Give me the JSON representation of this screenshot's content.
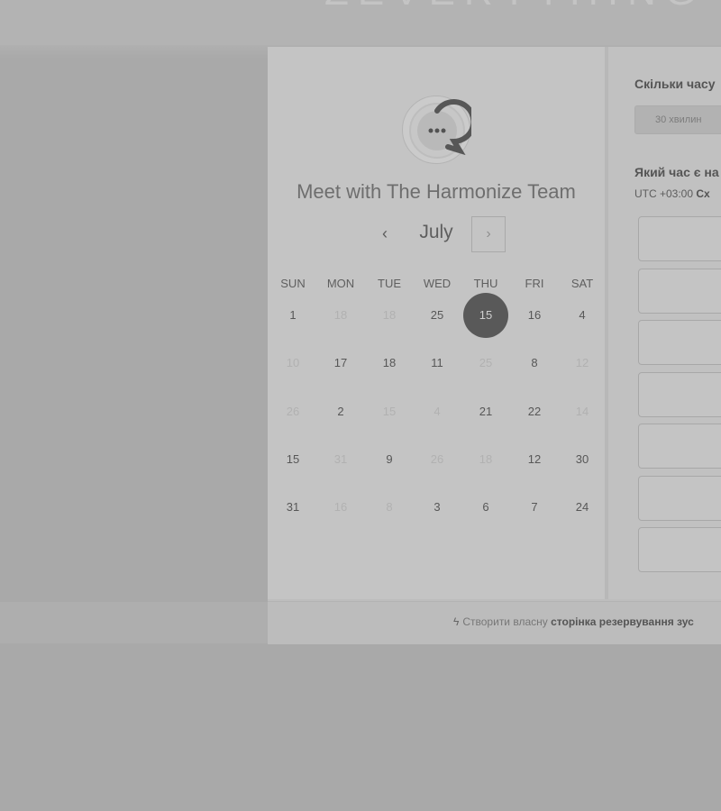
{
  "meeting": {
    "title": "Meet with The Harmonize Team",
    "avatar_icon": "chat-dots-icon"
  },
  "calendar": {
    "month": "July",
    "prev_icon": "chevron-left-icon",
    "next_icon": "chevron-right-icon",
    "weekdays": [
      "SUN",
      "MON",
      "TUE",
      "WED",
      "THU",
      "FRI",
      "SAT"
    ],
    "weeks": [
      [
        {
          "d": "1",
          "muted": false
        },
        {
          "d": "18",
          "muted": true
        },
        {
          "d": "18",
          "muted": true
        },
        {
          "d": "25",
          "muted": false
        },
        {
          "d": "15",
          "muted": false,
          "selected": true
        },
        {
          "d": "16",
          "muted": false
        },
        {
          "d": "4",
          "muted": false
        }
      ],
      [
        {
          "d": "10",
          "muted": true
        },
        {
          "d": "17",
          "muted": false
        },
        {
          "d": "18",
          "muted": false
        },
        {
          "d": "11",
          "muted": false
        },
        {
          "d": "25",
          "muted": true
        },
        {
          "d": "8",
          "muted": false
        },
        {
          "d": "12",
          "muted": true
        }
      ],
      [
        {
          "d": "26",
          "muted": true
        },
        {
          "d": "2",
          "muted": false
        },
        {
          "d": "15",
          "muted": true
        },
        {
          "d": "4",
          "muted": true
        },
        {
          "d": "21",
          "muted": false
        },
        {
          "d": "22",
          "muted": false
        },
        {
          "d": "14",
          "muted": true
        }
      ],
      [
        {
          "d": "15",
          "muted": false
        },
        {
          "d": "31",
          "muted": true
        },
        {
          "d": "9",
          "muted": false
        },
        {
          "d": "26",
          "muted": true
        },
        {
          "d": "18",
          "muted": true
        },
        {
          "d": "12",
          "muted": false
        },
        {
          "d": "30",
          "muted": false
        }
      ],
      [
        {
          "d": "31",
          "muted": false
        },
        {
          "d": "16",
          "muted": true
        },
        {
          "d": "8",
          "muted": true
        },
        {
          "d": "3",
          "muted": false
        },
        {
          "d": "6",
          "muted": false
        },
        {
          "d": "7",
          "muted": false
        },
        {
          "d": "24",
          "muted": false
        }
      ]
    ]
  },
  "booking": {
    "duration_heading": "Скільки часу",
    "duration_option": "30 хвилин",
    "time_heading": "Який час є на",
    "timezone_prefix": "UTC +03:00 ",
    "timezone_bold": "Сх",
    "slot_count": 7
  },
  "footer": {
    "icon": "hubspot-sprocket-icon",
    "text": "Створити власну ",
    "link": "сторінка резервування зус"
  },
  "colors": {
    "selected_day": "#595959",
    "background": "#a9a9a9"
  }
}
